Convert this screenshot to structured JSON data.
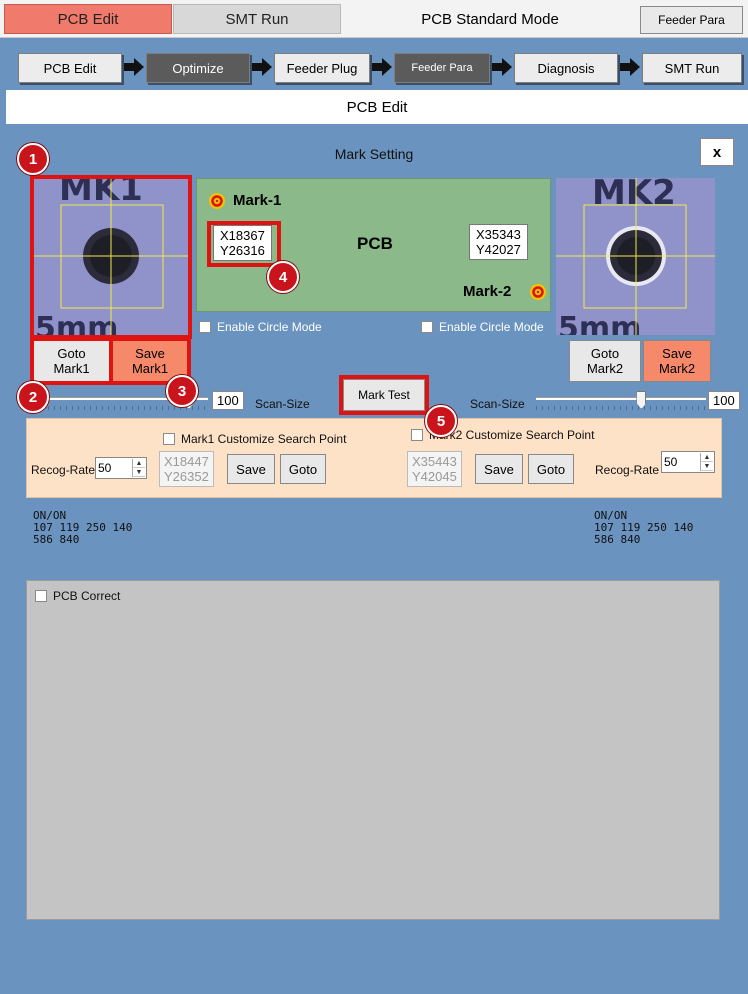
{
  "tabs": {
    "pcb_edit": "PCB Edit",
    "smt_run": "SMT Run",
    "mode_title": "PCB Standard Mode",
    "feeder_para": "Feeder Para"
  },
  "workflow": [
    {
      "label": "PCB Edit"
    },
    {
      "label": "Optimize"
    },
    {
      "label": "Feeder Plug"
    },
    {
      "label": "Feeder Para"
    },
    {
      "label": "Diagnosis"
    },
    {
      "label": "SMT Run"
    }
  ],
  "page_title": "PCB Edit",
  "mark_setting": {
    "title": "Mark Setting",
    "close": "x",
    "mark1": {
      "cam_text": "MK1",
      "cam_text_bottom": "5mm",
      "label": "Mark-1",
      "coord_x": "X18367",
      "coord_y": "Y26316",
      "goto_line1": "Goto",
      "goto_line2": "Mark1",
      "save_line1": "Save",
      "save_line2": "Mark1",
      "circle_mode": "Enable Circle Mode",
      "scan_value": "100",
      "scan_label": "Scan-Size",
      "customize_label": "Mark1 Customize Search Point",
      "recog_label": "Recog-Rate",
      "recog_value": "50",
      "custom_x": "X18447",
      "custom_y": "Y26352",
      "save": "Save",
      "goto": "Goto",
      "status_line1": "ON/ON",
      "status_line2": "107 119 250 140",
      "status_line3": "586 840"
    },
    "mark2": {
      "cam_text": "MK2",
      "cam_text_bottom": "5mm",
      "label": "Mark-2",
      "coord_x": "X35343",
      "coord_y": "Y42027",
      "goto_line1": "Goto",
      "goto_line2": "Mark2",
      "save_line1": "Save",
      "save_line2": "Mark2",
      "circle_mode": "Enable Circle Mode",
      "scan_value": "100",
      "scan_label": "Scan-Size",
      "customize_label": "Mark2 Customize Search Point",
      "recog_label": "Recog-Rate",
      "recog_value": "50",
      "custom_x": "X35443",
      "custom_y": "Y42045",
      "save": "Save",
      "goto": "Goto",
      "status_line1": "ON/ON",
      "status_line2": "107 119 250 140",
      "status_line3": "586 840"
    },
    "pcb_label": "PCB",
    "mark_test": "Mark Test"
  },
  "badges": [
    "1",
    "2",
    "3",
    "4",
    "5"
  ],
  "pcb_correct": "PCB Correct",
  "sliders": {
    "mark1_level": 0.88,
    "mark2_level": 0.62
  },
  "colors": {
    "background": "#6b93bf",
    "active_tab": "#f07a6b",
    "save_button": "#f7896b",
    "pcb_board": "#8bb98a",
    "search_panel": "#fde2c8",
    "highlight": "#e01313"
  }
}
